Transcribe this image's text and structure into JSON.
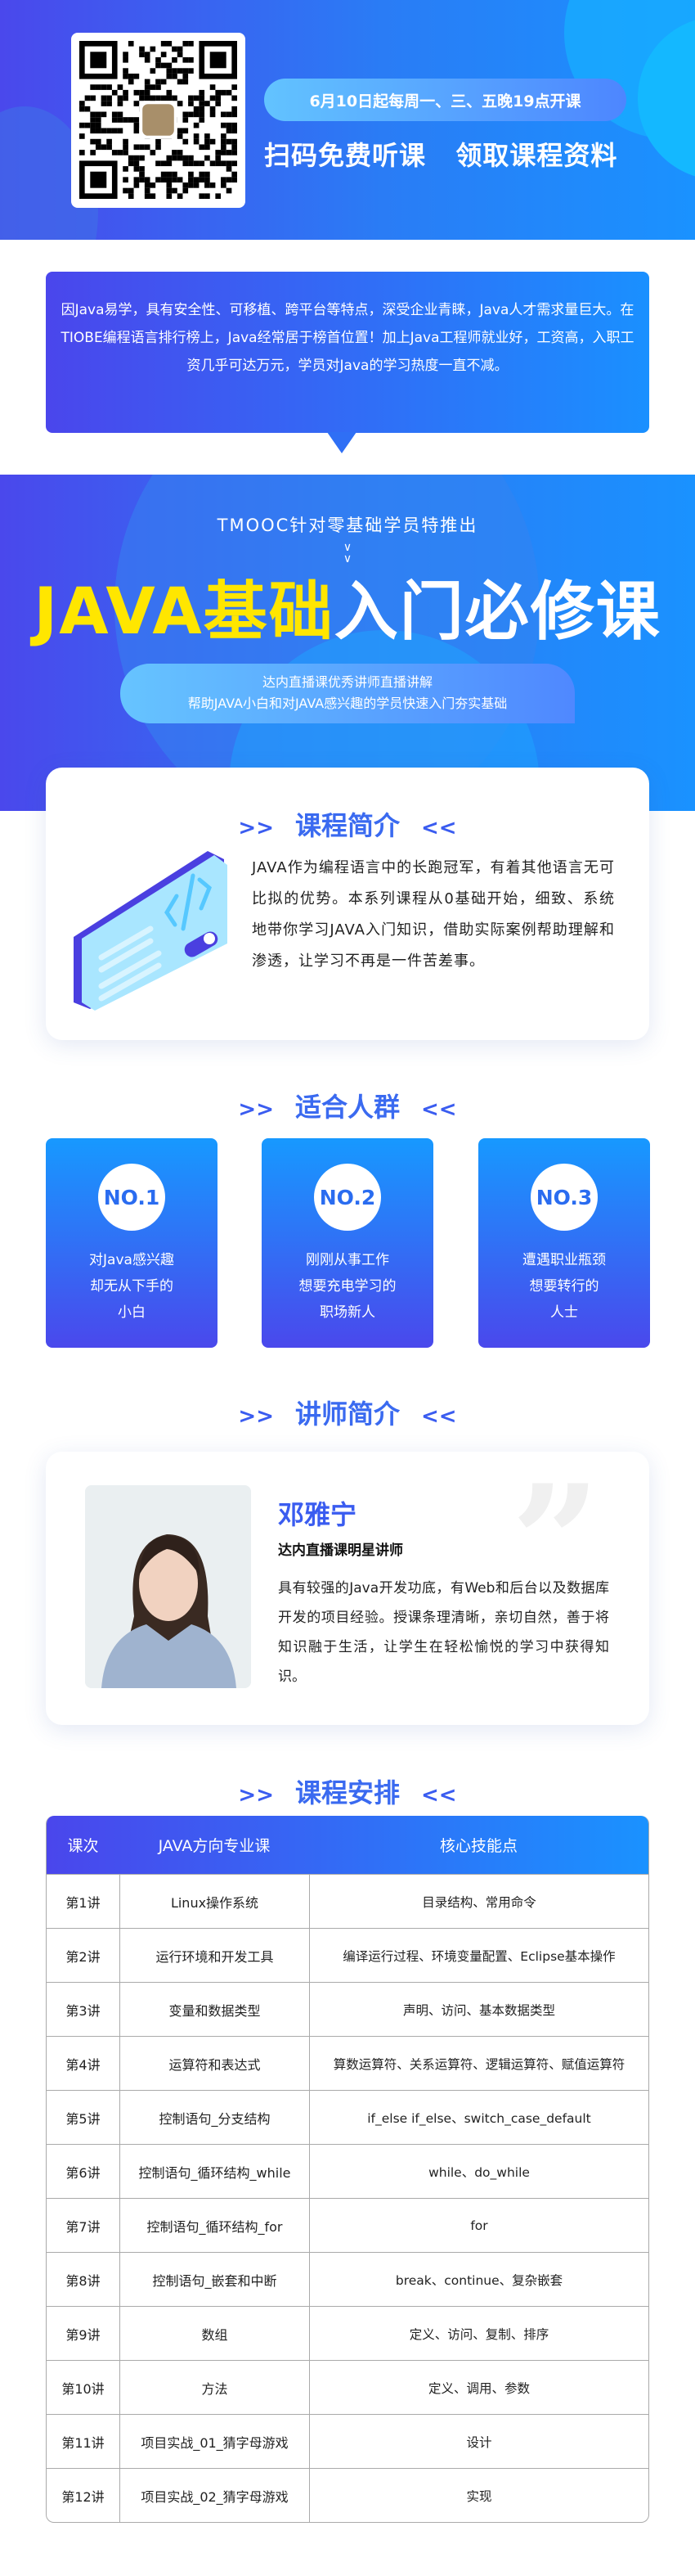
{
  "colors": {
    "gradient_start": "#4a46ec",
    "gradient_end": "#1a92ff",
    "title_yellow": "#ffe600",
    "heading_blue": "#3a6af0"
  },
  "hero": {
    "qr_icon": "qr-code-icon",
    "schedule": "6月10日起每周一、三、五晚19点开课",
    "cta": "扫码免费听课   领取课程资料"
  },
  "intro": {
    "text": "因Java易学，具有安全性、可移植、跨平台等特点，深受企业青睐，Java人才需求量巨大。在TIOBE编程语言排行榜上，Java经常居于榜首位置！加上Java工程师就业好，工资高，入职工资几乎可达万元，学员对Java的学习热度一直不减。"
  },
  "banner": {
    "tagline": "TMOOC针对零基础学员特推出",
    "chevrons": "∨\n∨",
    "title_yellow": "JAVA基础",
    "title_white": "入门必修课",
    "sub_line1": "达内直播课优秀讲师直播讲解",
    "sub_line2": "帮助JAVA小白和对JAVA感兴趣的学员快速入门夯实基础"
  },
  "arrows": {
    "left": ">>",
    "right": "<<"
  },
  "course_intro": {
    "heading": "课程简介",
    "text": "JAVA作为编程语言中的长跑冠军，有着其他语言无可比拟的优势。本系列课程从0基础开始，细致、系统地带你学习JAVA入门知识，借助实际案例帮助理解和渗透，让学习不再是一件苦差事。"
  },
  "audience": {
    "heading": "适合人群",
    "items": [
      {
        "badge": "NO.1",
        "lines": [
          "对Java感兴趣",
          "却无从下手的",
          "小白"
        ]
      },
      {
        "badge": "NO.2",
        "lines": [
          "刚刚从事工作",
          "想要充电学习的",
          "职场新人"
        ]
      },
      {
        "badge": "NO.3",
        "lines": [
          "遭遇职业瓶颈",
          "想要转行的",
          "人士"
        ]
      }
    ]
  },
  "teacher": {
    "heading": "讲师简介",
    "name": "邓雅宁",
    "title": "达内直播课明星讲师",
    "bio": "具有较强的Java开发功底，有Web和后台以及数据库开发的项目经验。授课条理清晰，亲切自然，善于将知识融于生活，让学生在轻松愉悦的学习中获得知识。",
    "quote_mark": "”"
  },
  "schedule": {
    "heading": "课程安排",
    "columns": [
      "课次",
      "JAVA方向专业课",
      "核心技能点"
    ],
    "rows": [
      [
        "第1讲",
        "Linux操作系统",
        "目录结构、常用命令"
      ],
      [
        "第2讲",
        "运行环境和开发工具",
        "编译运行过程、环境变量配置、Eclipse基本操作"
      ],
      [
        "第3讲",
        "变量和数据类型",
        "声明、访问、基本数据类型"
      ],
      [
        "第4讲",
        "运算符和表达式",
        "算数运算符、关系运算符、逻辑运算符、赋值运算符"
      ],
      [
        "第5讲",
        "控制语句_分支结构",
        "if_else if_else、switch_case_default"
      ],
      [
        "第6讲",
        "控制语句_循环结构_while",
        "while、do_while"
      ],
      [
        "第7讲",
        "控制语句_循环结构_for",
        "for"
      ],
      [
        "第8讲",
        "控制语句_嵌套和中断",
        "break、continue、复杂嵌套"
      ],
      [
        "第9讲",
        "数组",
        "定义、访问、复制、排序"
      ],
      [
        "第10讲",
        "方法",
        "定义、调用、参数"
      ],
      [
        "第11讲",
        "项目实战_01_猜字母游戏",
        "设计"
      ],
      [
        "第12讲",
        "项目实战_02_猜字母游戏",
        "实现"
      ]
    ]
  }
}
